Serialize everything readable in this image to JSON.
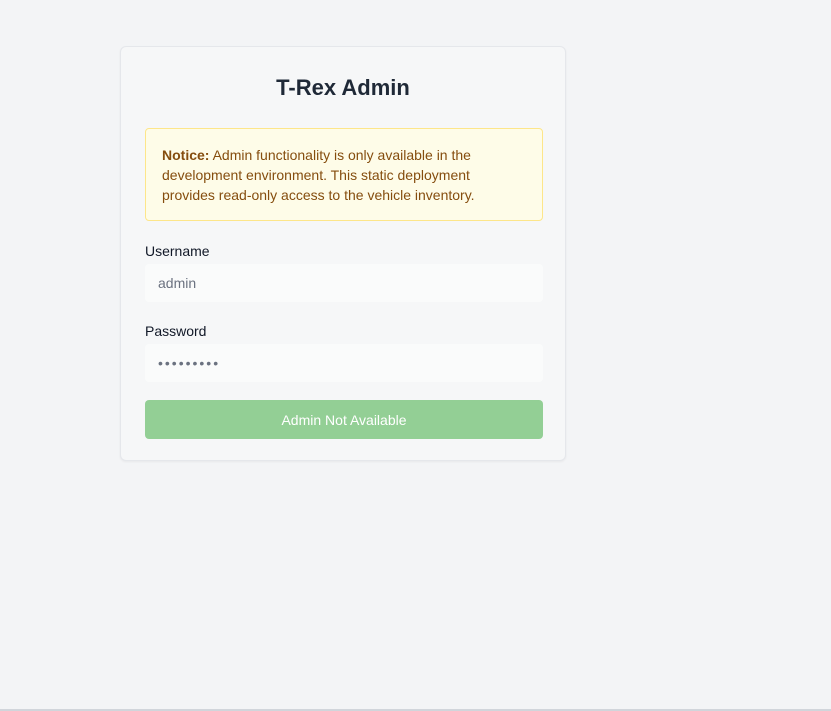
{
  "card": {
    "title": "T-Rex Admin",
    "notice": {
      "label": "Notice:",
      "message": "Admin functionality is only available in the development environment. This static deployment provides read-only access to the vehicle inventory."
    },
    "username": {
      "label": "Username",
      "value": "admin"
    },
    "password": {
      "label": "Password",
      "value": "•••••••••"
    },
    "submit_label": "Admin Not Available"
  },
  "colors": {
    "background": "#f3f4f6",
    "card": "#f6f7f8",
    "notice_background": "#fefce8",
    "notice_border": "#fde68a",
    "notice_text": "#854d0e",
    "button_disabled": "#93cf95"
  }
}
